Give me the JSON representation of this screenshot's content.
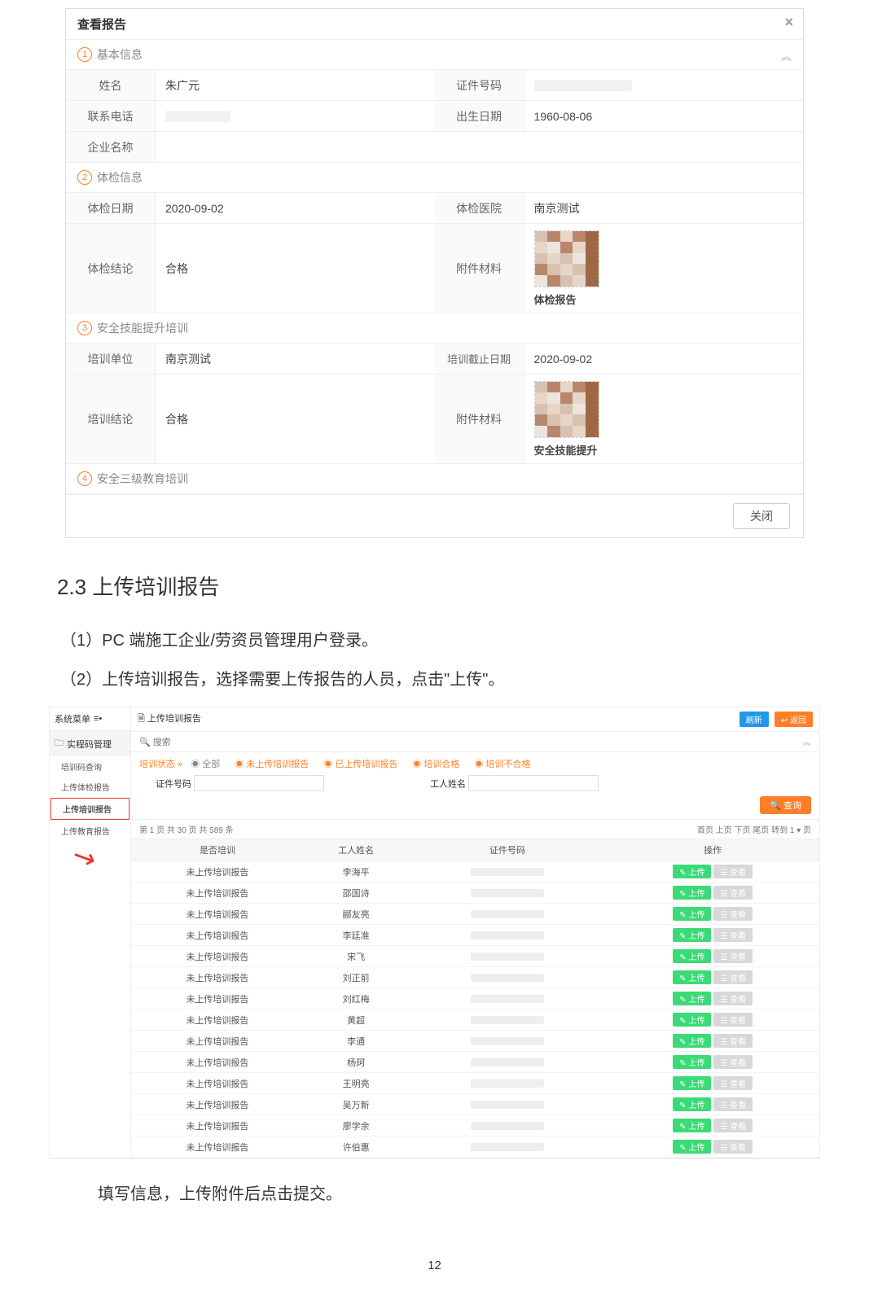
{
  "dialog": {
    "title": "查看报告",
    "close_btn": "关闭",
    "sections": {
      "s1": {
        "num": "1",
        "title": "基本信息",
        "name_l": "姓名",
        "name_v": "朱广元",
        "id_l": "证件号码",
        "id_v": "",
        "tel_l": "联系电话",
        "tel_v": "",
        "dob_l": "出生日期",
        "dob_v": "1960-08-06",
        "co_l": "企业名称",
        "co_v": ""
      },
      "s2": {
        "num": "2",
        "title": "体检信息",
        "date_l": "体检日期",
        "date_v": "2020-09-02",
        "hosp_l": "体检医院",
        "hosp_v": "南京测试",
        "concl_l": "体检结论",
        "concl_v": "合格",
        "att_l": "附件材料",
        "att_name": "体检报告"
      },
      "s3": {
        "num": "3",
        "title": "安全技能提升培训",
        "org_l": "培训单位",
        "org_v": "南京测试",
        "end_l": "培训截止日期",
        "end_v": "2020-09-02",
        "concl_l": "培训结论",
        "concl_v": "合格",
        "att_l": "附件材料",
        "att_name": "安全技能提升"
      },
      "s4": {
        "num": "4",
        "title": "安全三级教育培训"
      }
    }
  },
  "doc": {
    "heading": "2.3 上传培训报告",
    "p1": "（1）PC 端施工企业/劳资员管理用户登录。",
    "p2": "（2）上传培训报告，选择需要上传报告的人员，点击\"上传\"。",
    "p3": "填写信息，上传附件后点击提交。",
    "page_num": "12"
  },
  "shot2": {
    "side_head": "系统菜单",
    "menu_header": "实程码管理",
    "menu_items": [
      "培训码查询",
      "上传体检报告",
      "上传培训报告",
      "上传教育报告"
    ],
    "highlighted_idx": 2,
    "tab_title": "上传培训报告",
    "btn_refresh": "刷新",
    "btn_back": "返回",
    "search_label": "搜索",
    "filter_status_label": "培训状态 »",
    "filter_radios": [
      "全部",
      "未上传培训报告",
      "已上传培训报告",
      "培训合格",
      "培训不合格"
    ],
    "filter_id_label": "证件号码",
    "filter_name_label": "工人姓名",
    "btn_search": "查询",
    "pager_left": "第 1 页 共 30 页 共 589 条",
    "pager_right": "首页 上页 下页 尾页 转到 1 ▾ 页",
    "cols": [
      "是否培训",
      "工人姓名",
      "证件号码",
      "操作"
    ],
    "status_text": "未上传培训报告",
    "btn_upload": "上传",
    "btn_view": "查看",
    "rows": [
      "李海平",
      "邵国诗",
      "郦友亮",
      "李廷准",
      "宋飞",
      "刘正前",
      "刘红梅",
      "黄超",
      "李通",
      "杨珂",
      "王明亮",
      "吴万新",
      "廖学余",
      "许伯惠"
    ]
  }
}
